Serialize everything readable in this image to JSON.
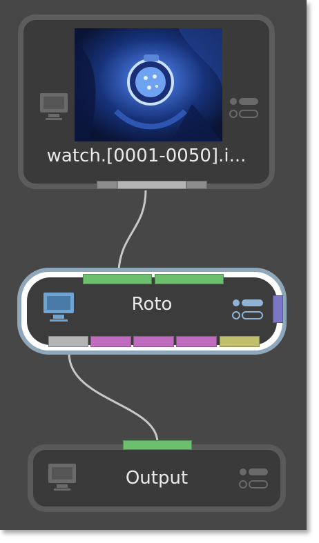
{
  "nodes": {
    "source": {
      "title": "watch.[0001-0050].i...",
      "thumbnail_icon": "image-thumbnail",
      "view_icon": "monitor-icon",
      "options_icon": "options-list-icon"
    },
    "roto": {
      "title": "Roto",
      "selected": true,
      "view_icon": "monitor-icon",
      "options_icon": "options-list-icon",
      "accent_color": "#8fa7ba"
    },
    "output": {
      "title": "Output",
      "view_icon": "monitor-icon",
      "options_icon": "options-list-icon"
    }
  },
  "port_colors": {
    "gray": "#8c8c8c",
    "light_gray": "#b4b4b4",
    "green": "#6cbf6c",
    "magenta": "#bf6cbf",
    "yellow": "#bfbf6c",
    "purple": "#7a78c4"
  }
}
